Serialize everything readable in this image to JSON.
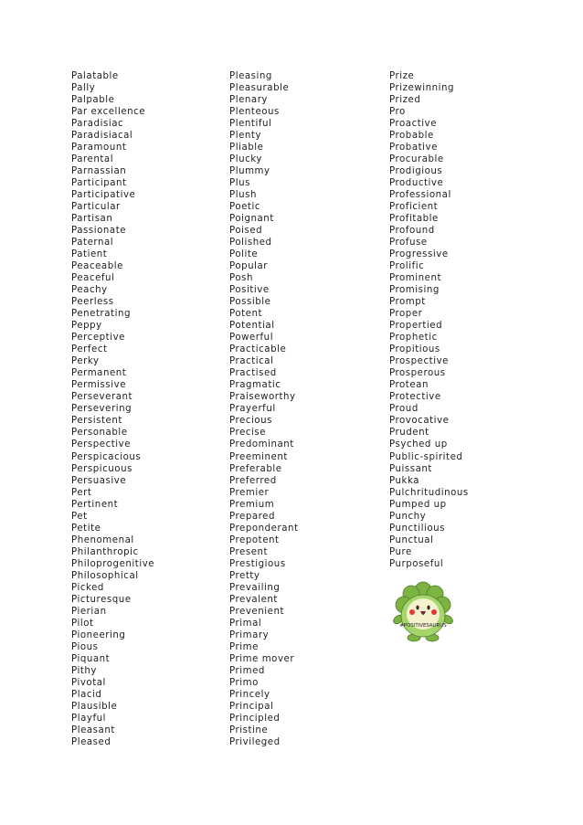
{
  "columns": [
    {
      "words": [
        "Palatable",
        "Pally",
        "Palpable",
        "Par excellence",
        "Paradisiac",
        "Paradisiacal",
        "Paramount",
        "Parental",
        "Parnassian",
        "Participant",
        "Participative",
        "Particular",
        "Partisan",
        "Passionate",
        "Paternal",
        "Patient",
        "Peaceable",
        "Peaceful",
        "Peachy",
        "Peerless",
        "Penetrating",
        "Peppy",
        "Perceptive",
        "Perfect",
        "Perky",
        "Permanent",
        "Permissive",
        "Perseverant",
        "Persevering",
        "Persistent",
        "Personable",
        "Perspective",
        "Perspicacious",
        "Perspicuous",
        "Persuasive",
        "Pert",
        "Pertinent",
        "Pet",
        "Petite",
        "Phenomenal",
        "Philanthropic",
        "Philoprogenitive",
        "Philosophical",
        "Picked",
        "Picturesque",
        "Pierian",
        "Pilot",
        "Pioneering",
        "Pious",
        "Piquant",
        "Pithy",
        "Pivotal",
        "Placid",
        "Plausible",
        "Playful",
        "Pleasant",
        "Pleased"
      ]
    },
    {
      "words": [
        "Pleasing",
        "Pleasurable",
        "Plenary",
        "Plenteous",
        "Plentiful",
        "Plenty",
        "Pliable",
        "Plucky",
        "Plummy",
        "Plus",
        "Plush",
        "Poetic",
        "Poignant",
        "Poised",
        "Polished",
        "Polite",
        "Popular",
        "Posh",
        "Positive",
        "Possible",
        "Potent",
        "Potential",
        "Powerful",
        "Practicable",
        "Practical",
        "Practised",
        "Pragmatic",
        "Praiseworthy",
        "Prayerful",
        "Precious",
        "Precise",
        "Predominant",
        "Preeminent",
        "Preferable",
        "Preferred",
        "Premier",
        "Premium",
        "Prepared",
        "Preponderant",
        "Prepotent",
        "Present",
        "Prestigious",
        "Pretty",
        "Prevailing",
        "Prevalent",
        "Prevenient",
        "Primal",
        "Primary",
        "Prime",
        "Prime  mover",
        "Primed",
        "Primo",
        "Princely",
        "Principal",
        "Principled",
        "Pristine",
        "Privileged"
      ]
    },
    {
      "words": [
        "Prize",
        "Prizewinning",
        "Prized",
        "Pro",
        "Proactive",
        "Probable",
        "Probative",
        "Procurable",
        "Prodigious",
        "Productive",
        "Professional",
        "Proficient",
        "Profitable",
        "Profound",
        "Profuse",
        "Progressive",
        "Prolific",
        "Prominent",
        "Promising",
        "Prompt",
        "Proper",
        "Propertied",
        "Prophetic",
        "Propitious",
        "Prospective",
        "Prosperous",
        "Protean",
        "Protective",
        "Proud",
        "Provocative",
        "Prudent",
        "Psyched up",
        "Public-spirited",
        "Puissant",
        "Pukka",
        "Pulchritudinous",
        "Pumped  up",
        "Punchy",
        "Punctilious",
        "Punctual",
        "Pure",
        "Purposeful"
      ]
    }
  ],
  "mascot": {
    "caption": "#POSITIVESAURUS",
    "colors": {
      "body_dark": "#7cb342",
      "body_light": "#a5d66b",
      "belly": "#f4f1cf",
      "cheek": "#e53935",
      "outline": "#4e7a25"
    }
  }
}
